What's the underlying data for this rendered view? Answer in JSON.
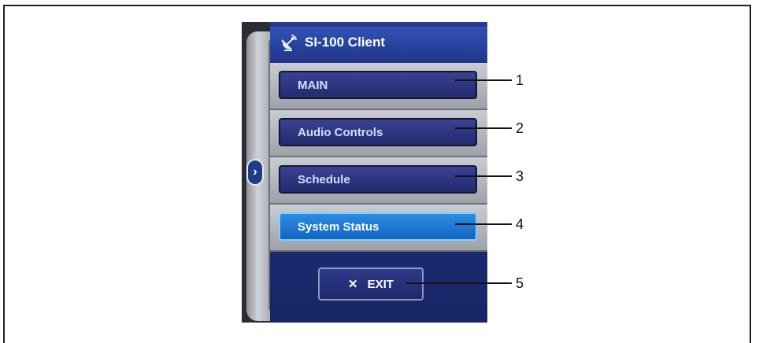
{
  "app": {
    "title": "SI-100 Client",
    "title_icon": "satellite-dish-icon"
  },
  "menu": {
    "items": [
      {
        "label": "MAIN",
        "callout": "1",
        "active": false
      },
      {
        "label": "Audio Controls",
        "callout": "2",
        "active": false
      },
      {
        "label": "Schedule",
        "callout": "3",
        "active": false
      },
      {
        "label": "System Status",
        "callout": "4",
        "active": true
      }
    ],
    "exit": {
      "label": "EXIT",
      "icon": "close-icon",
      "callout": "5"
    }
  },
  "side_toggle": {
    "icon": "chevron-right-icon"
  },
  "colors": {
    "panel_blue": "#1c2a72",
    "button_blue": "#2a3180",
    "active_blue": "#1a78d6",
    "row_gray": "#b4b7be"
  }
}
